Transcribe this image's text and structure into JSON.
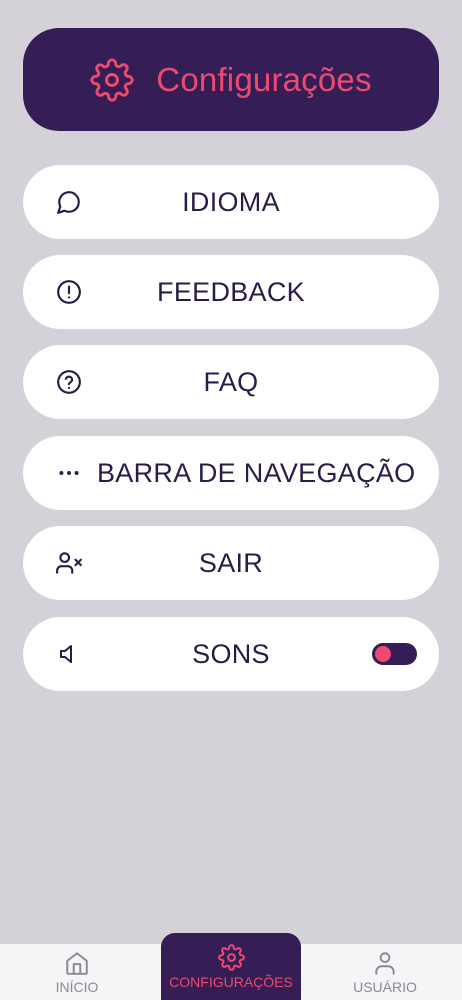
{
  "header": {
    "title": "Configurações",
    "icon": "gear-icon"
  },
  "menu": {
    "items": [
      {
        "label": "IDIOMA",
        "icon": "speech-bubble-icon"
      },
      {
        "label": "FEEDBACK",
        "icon": "alert-circle-icon"
      },
      {
        "label": "FAQ",
        "icon": "help-circle-icon"
      },
      {
        "label": "BARRA DE NAVEGAÇÃO",
        "icon": "more-horizontal-icon"
      },
      {
        "label": "SAIR",
        "icon": "user-x-icon"
      },
      {
        "label": "SONS",
        "icon": "volume-icon",
        "toggle_on": true
      }
    ]
  },
  "bottom_nav": {
    "items": [
      {
        "label": "INÍCIO",
        "icon": "home-icon",
        "active": false
      },
      {
        "label": "CONFIGURAÇÕES",
        "icon": "gear-icon",
        "active": true
      },
      {
        "label": "USUÁRIO",
        "icon": "user-icon",
        "active": false
      }
    ]
  },
  "colors": {
    "background": "#d4d1d8",
    "primary": "#351e56",
    "accent": "#ee4970",
    "surface": "#ffffff",
    "text": "#2a1c47"
  }
}
